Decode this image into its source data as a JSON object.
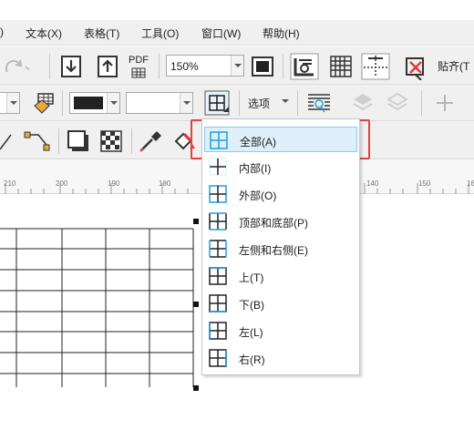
{
  "menubar": {
    "items": [
      {
        "name": "view",
        "label": ")"
      },
      {
        "name": "text",
        "label": "文本(X)"
      },
      {
        "name": "table",
        "label": "表格(T)"
      },
      {
        "name": "tools",
        "label": "工具(O)"
      },
      {
        "name": "window",
        "label": "窗口(W)"
      },
      {
        "name": "help",
        "label": "帮助(H)"
      }
    ]
  },
  "toolbar1": {
    "pdf_label": "PDF",
    "zoom_value": "150%",
    "snap_label": "贴齐(T"
  },
  "toolbar2": {
    "options_label": "选项"
  },
  "ruler": {
    "ticks": [
      "210",
      "200",
      "190",
      "180",
      "140",
      "150",
      "160"
    ]
  },
  "border_menu": {
    "items": [
      {
        "label": "全部(A)",
        "icon": "border-all-icon",
        "selected": true
      },
      {
        "label": "内部(I)",
        "icon": "border-inside-icon"
      },
      {
        "label": "外部(O)",
        "icon": "border-outside-icon"
      },
      {
        "label": "顶部和底部(P)",
        "icon": "border-top-bottom-icon"
      },
      {
        "label": "左侧和右侧(E)",
        "icon": "border-left-right-icon"
      },
      {
        "label": "上(T)",
        "icon": "border-top-icon"
      },
      {
        "label": "下(B)",
        "icon": "border-bottom-icon"
      },
      {
        "label": "左(L)",
        "icon": "border-left-icon"
      },
      {
        "label": "右(R)",
        "icon": "border-right-icon"
      }
    ]
  },
  "colors": {
    "highlight": "#e8403f",
    "selected_bg": "#dff0fb",
    "accent": "#1ea0dc"
  }
}
